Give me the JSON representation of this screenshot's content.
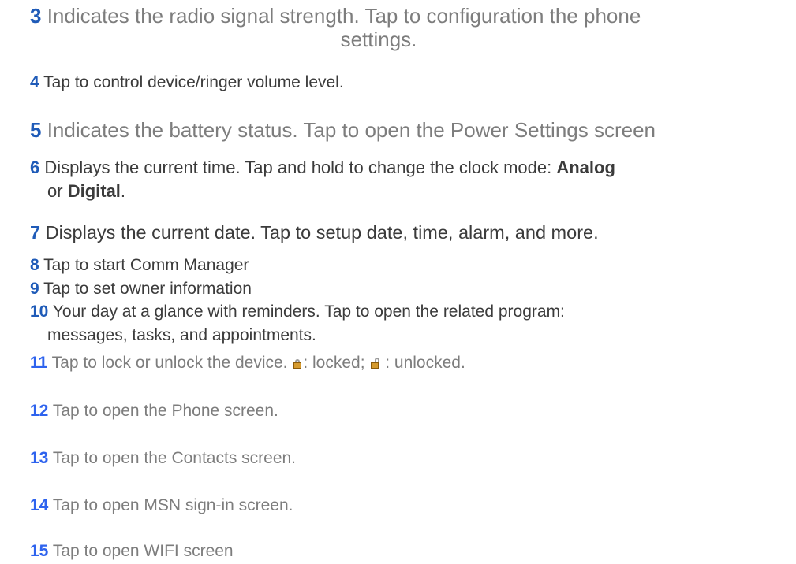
{
  "items": [
    {
      "num": "3",
      "text": "Indicates the radio signal strength. Tap to configuration the phone",
      "text2": "settings."
    },
    {
      "num": "4",
      "text": "Tap to control device/ringer volume level."
    },
    {
      "num": "5",
      "text": "Indicates the battery status. Tap to open the Power Settings screen"
    },
    {
      "num": "6",
      "text_a": "Displays the current time. Tap and hold to change the clock mode: ",
      "bold_a": "Analog",
      "text_b": "or ",
      "bold_b": "Digital",
      "text_c": "."
    },
    {
      "num": "7",
      "text": "Displays the current date. Tap to setup date, time, alarm, and more."
    },
    {
      "num": "8",
      "text": "Tap to start Comm Manager"
    },
    {
      "num": "9",
      "text": "Tap to set owner information"
    },
    {
      "num": "10",
      "text": "Your day at a glance with reminders. Tap to open the related program:",
      "text2": "messages, tasks, and appointments."
    },
    {
      "num": "11",
      "text_a": "Tap to lock or unlock the device. ",
      "text_b": ": locked; ",
      "text_c": " : unlocked."
    },
    {
      "num": "12",
      "text": "Tap to open the Phone screen."
    },
    {
      "num": "13",
      "text": "Tap to open the Contacts screen."
    },
    {
      "num": "14",
      "text": "Tap to open MSN sign-in screen."
    },
    {
      "num": "15",
      "text": "Tap to open WIFI screen"
    }
  ],
  "icons": {
    "locked": "locked-padlock-icon",
    "unlocked": "unlocked-padlock-icon",
    "lock_body_color": "#d59a2e"
  }
}
